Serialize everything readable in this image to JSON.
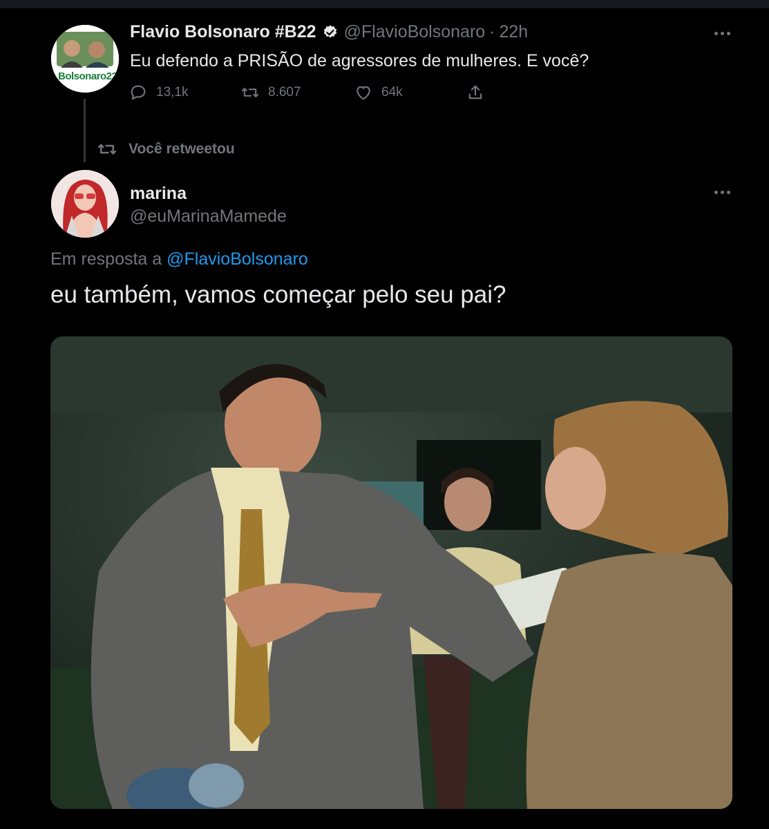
{
  "tweet1": {
    "author_name": "Flavio Bolsonaro #B22",
    "handle": "@FlavioBolsonaro",
    "separator": "·",
    "time": "22h",
    "avatar_text": "Bolsonaro22",
    "text": "Eu defendo a PRISÃO de agressores de mulheres. E você?",
    "replies": "13,1k",
    "retweets": "8.607",
    "likes": "64k",
    "icons": {
      "verified": "verified-badge-icon",
      "reply": "reply-icon",
      "retweet": "retweet-icon",
      "like": "heart-icon",
      "share": "share-icon",
      "more": "more-icon"
    }
  },
  "retweet_note": {
    "label": "Você retweetou",
    "icon": "retweet-icon"
  },
  "tweet2": {
    "author_name": "marina",
    "handle": "@euMarinaMamede",
    "reply_prefix": "Em resposta a",
    "reply_target": "@FlavioBolsonaro",
    "text": "eu também, vamos começar pelo seu pai?",
    "media_description_icon": "photo-icon"
  },
  "colors": {
    "background": "#000000",
    "text": "#e7e9ea",
    "muted": "#71767b",
    "link": "#1d9bf0"
  }
}
